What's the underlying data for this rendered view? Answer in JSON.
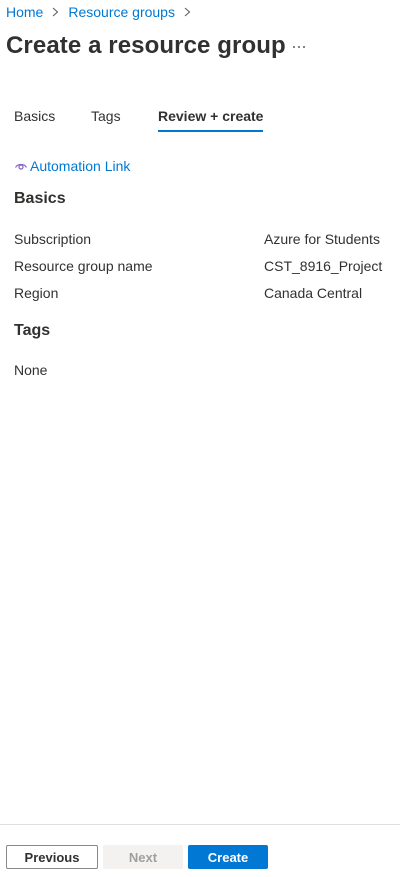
{
  "breadcrumb": {
    "items": [
      {
        "label": "Home"
      },
      {
        "label": "Resource groups"
      }
    ]
  },
  "page": {
    "title": "Create a resource group",
    "more_label": "..."
  },
  "tabs": [
    {
      "label": "Basics",
      "active": false
    },
    {
      "label": "Tags",
      "active": false
    },
    {
      "label": "Review + create",
      "active": true
    }
  ],
  "automation_link": {
    "label": "Automation Link",
    "icon": "eye-icon"
  },
  "summary": {
    "basics": {
      "heading": "Basics",
      "rows": [
        {
          "label": "Subscription",
          "value": "Azure for Students"
        },
        {
          "label": "Resource group name",
          "value": "CST_8916_Project"
        },
        {
          "label": "Region",
          "value": "Canada Central"
        }
      ]
    },
    "tags": {
      "heading": "Tags",
      "value": "None"
    }
  },
  "footer": {
    "previous_label": "Previous",
    "next_label": "Next",
    "create_label": "Create"
  },
  "colors": {
    "accent": "#0078d4",
    "text": "#323130",
    "disabled_text": "#a19f9d",
    "disabled_bg": "#f3f2f1",
    "divider": "#e1dfdd"
  }
}
